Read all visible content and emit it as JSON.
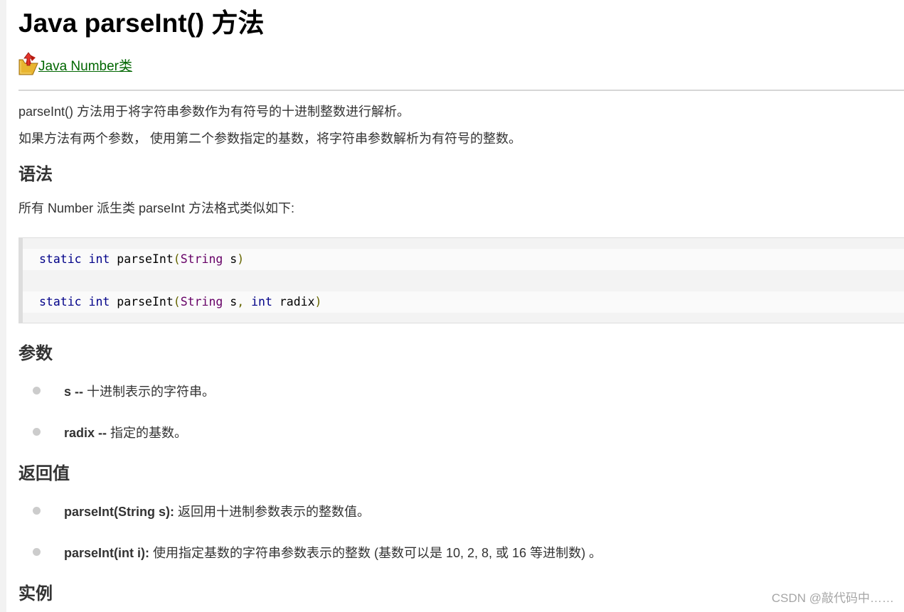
{
  "article": {
    "title": "Java parseInt() 方法",
    "back_link": {
      "label": "Java Number类",
      "icon": "folder-up-icon"
    },
    "intro": [
      "parseInt() 方法用于将字符串参数作为有符号的十进制整数进行解析。",
      "如果方法有两个参数， 使用第二个参数指定的基数，将字符串参数解析为有符号的整数。"
    ]
  },
  "syntax": {
    "heading": "语法",
    "description": "所有 Number 派生类 parseInt 方法格式类似如下:",
    "code_lines": [
      "static int parseInt(String s)",
      "static int parseInt(String s, int radix)"
    ]
  },
  "params": {
    "heading": "参数",
    "items": [
      {
        "term": "s --",
        "desc": " 十进制表示的字符串。"
      },
      {
        "term": "radix --",
        "desc": " 指定的基数。"
      }
    ]
  },
  "returns": {
    "heading": "返回值",
    "items": [
      {
        "term": "parseInt(String s):",
        "desc": " 返回用十进制参数表示的整数值。"
      },
      {
        "term": "parseInt(int i):",
        "desc": " 使用指定基数的字符串参数表示的整数 (基数可以是 10, 2, 8, 或 16 等进制数) 。"
      }
    ]
  },
  "examples": {
    "heading": "实例"
  },
  "watermark": "CSDN @敲代码中……",
  "colors": {
    "link": "#006600",
    "keyword": "#000088",
    "type": "#660066",
    "code_background": "#f3f3f3"
  }
}
